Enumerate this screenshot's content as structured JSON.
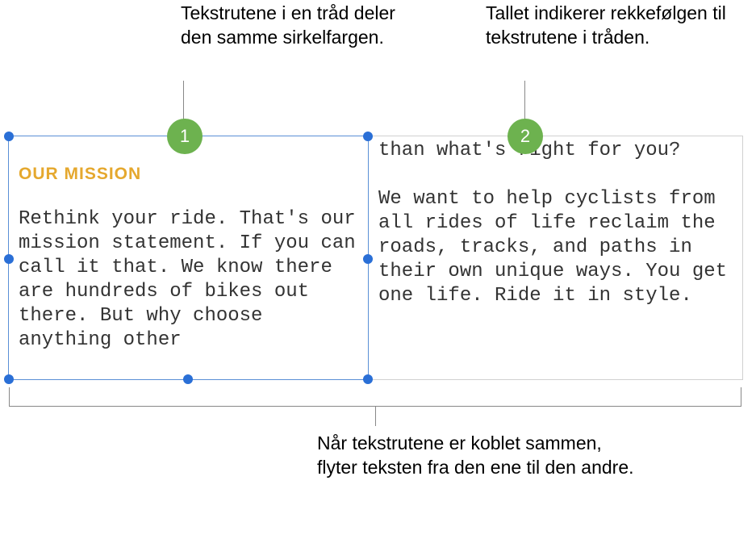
{
  "callouts": {
    "top_left": "Tekstrutene i en tråd deler den samme sirkelfargen.",
    "top_right": "Tallet indikerer rekkefølgen til tekstrutene i tråden.",
    "bottom": "Når tekstrutene er koblet sammen, flyter teksten fra den ene til den andre."
  },
  "badges": {
    "one": "1",
    "two": "2"
  },
  "box1": {
    "heading": "OUR MISSION",
    "body": "Rethink your ride. That's our mission statement. If you can call it that. We know there are hundreds of bikes out there. But why choose anything other"
  },
  "box2": {
    "body_part1": "than what's right for you?",
    "body_part2": "We want to help cyclists from all rides of life reclaim the roads, tracks, and paths in their own unique ways. You get one life. Ride it in style."
  }
}
